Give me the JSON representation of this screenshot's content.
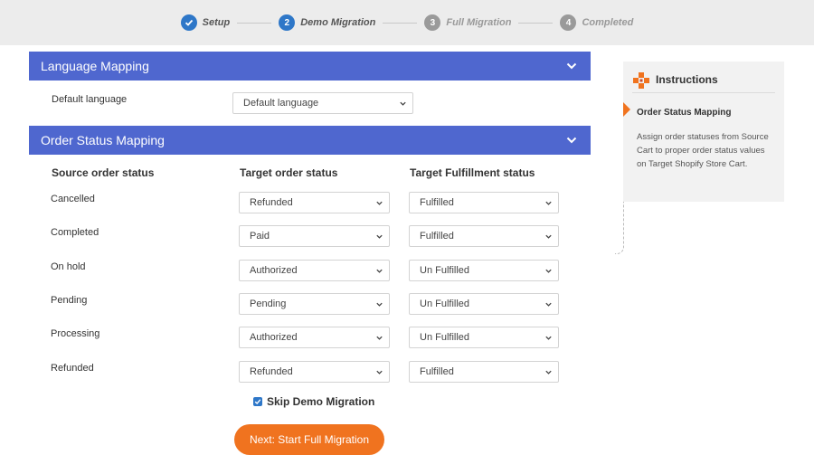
{
  "stepper": {
    "steps": [
      {
        "number": "✓",
        "label": "Setup",
        "state": "done"
      },
      {
        "number": "2",
        "label": "Demo Migration",
        "state": "active"
      },
      {
        "number": "3",
        "label": "Full Migration",
        "state": "pending"
      },
      {
        "number": "4",
        "label": "Completed",
        "state": "pending"
      }
    ]
  },
  "language_section": {
    "title": "Language Mapping",
    "default_language_label": "Default language",
    "default_language_value": "Default language"
  },
  "order_section": {
    "title": "Order Status Mapping",
    "col_source": "Source order status",
    "col_target": "Target order status",
    "col_fulfillment": "Target Fulfillment status",
    "rows": [
      {
        "source": "Cancelled",
        "target": "Refunded",
        "fulfillment": "Fulfilled"
      },
      {
        "source": "Completed",
        "target": "Paid",
        "fulfillment": "Fulfilled"
      },
      {
        "source": "On hold",
        "target": "Authorized",
        "fulfillment": "Un Fulfilled"
      },
      {
        "source": "Pending",
        "target": "Pending",
        "fulfillment": "Un Fulfilled"
      },
      {
        "source": "Processing",
        "target": "Authorized",
        "fulfillment": "Un Fulfilled"
      },
      {
        "source": "Refunded",
        "target": "Refunded",
        "fulfillment": "Fulfilled"
      }
    ]
  },
  "skip_demo": {
    "label": "Skip Demo Migration",
    "checked": true
  },
  "next_button": {
    "label": "Next: Start Full Migration"
  },
  "instructions": {
    "title": "Instructions",
    "subtitle": "Order Status Mapping",
    "body": "Assign order statuses from Source Cart to proper order status values on Target Shopify Store Cart."
  },
  "colors": {
    "header_blue": "#4f67cf",
    "accent_orange": "#f0731f",
    "step_blue": "#2e77c8"
  }
}
